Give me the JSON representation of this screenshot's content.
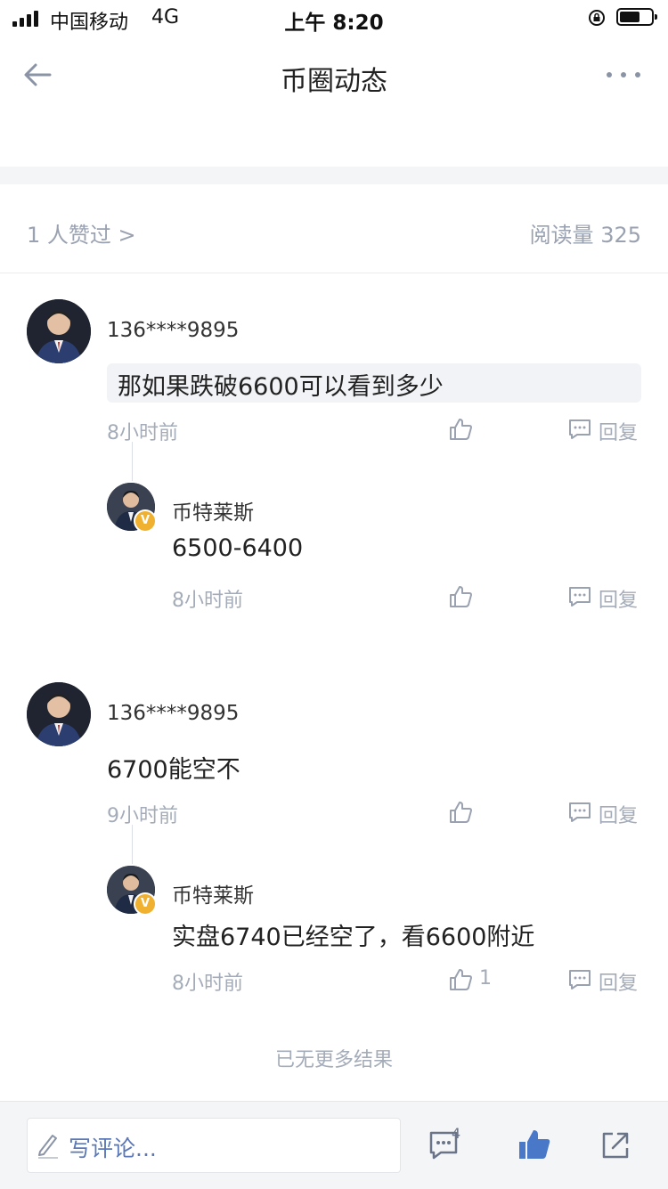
{
  "status_bar": {
    "carrier": "中国移动",
    "network": "4G",
    "time": "上午 8:20"
  },
  "header": {
    "title": "币圈动态"
  },
  "meta": {
    "likes_text": "1 人赞过 >",
    "reads_label": "阅读量 325"
  },
  "comments": [
    {
      "user": "136****9895",
      "text": "那如果跌破6600可以看到多少",
      "time": "8小时前",
      "reply_label": "回复",
      "replies": [
        {
          "user": "币特莱斯",
          "badge": "V",
          "text": "6500-6400",
          "time": "8小时前",
          "reply_label": "回复"
        }
      ]
    },
    {
      "user": "136****9895",
      "text": "6700能空不",
      "time": "9小时前",
      "reply_label": "回复",
      "replies": [
        {
          "user": "币特莱斯",
          "badge": "V",
          "text": "实盘6740已经空了，看6600附近",
          "time": "8小时前",
          "likes": "1",
          "reply_label": "回复"
        }
      ]
    }
  ],
  "end_text": "已无更多结果",
  "bottom_bar": {
    "input_placeholder": "写评论...",
    "comment_count": "4"
  },
  "colors": {
    "accent": "#4a78c8",
    "secondary_text": "#a4acb9",
    "badge": "#f0b130"
  }
}
